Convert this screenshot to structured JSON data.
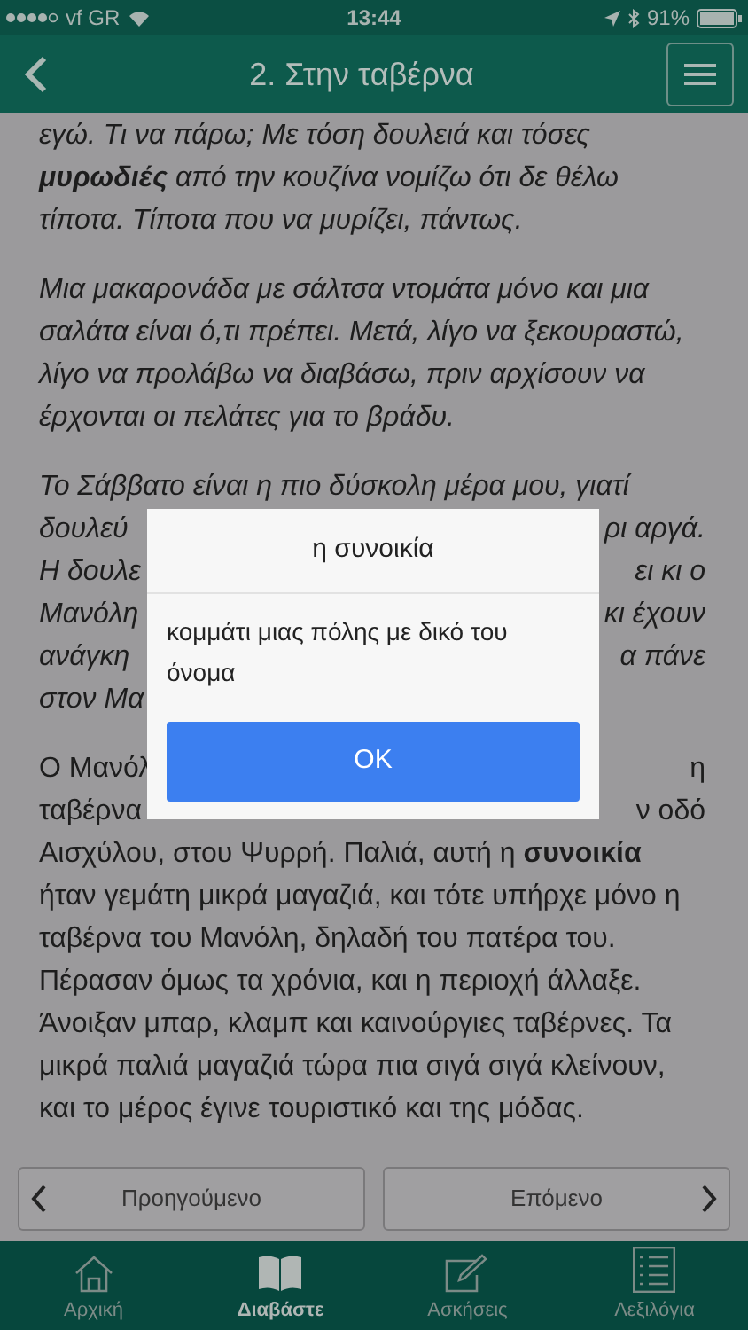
{
  "status_bar": {
    "carrier": "vf GR",
    "time": "13:44",
    "battery": "91%"
  },
  "header": {
    "title": "2. Στην ταβέρνα"
  },
  "paragraphs": [
    {
      "italic": true,
      "lines": [
        {
          "kind": "full",
          "text": "εγώ. Τι να πάρω; Με τόση δουλειά και τόσες"
        },
        {
          "kind": "full",
          "text": "**μυρωδιές** από την κουζίνα νομίζω ότι δε θέλω"
        },
        {
          "kind": "full",
          "text": "τίποτα. Τίποτα που να μυρίζει, πάντως."
        }
      ]
    },
    {
      "italic": true,
      "lines": [
        {
          "kind": "full",
          "text": "Μια μακαρονάδα με σάλτσα ντομάτα μόνο και μια"
        },
        {
          "kind": "full",
          "text": "σαλάτα είναι ό,τι πρέπει. Μετά, λίγο να ξεκουραστώ,"
        },
        {
          "kind": "full",
          "text": "λίγο να προλάβω να διαβάσω, πριν αρχίσουν να"
        },
        {
          "kind": "full",
          "text": "έρχονται οι πελάτες για το βράδυ."
        }
      ]
    },
    {
      "italic": true,
      "lines": [
        {
          "kind": "full",
          "text": "Το Σάββατο είναι η πιο δύσκολη μέρα μου, γιατί"
        },
        {
          "kind": "split",
          "left": "δουλεύ",
          "right": "ρι αργά."
        },
        {
          "kind": "split",
          "left": "Η δουλε",
          "right": "ει κι ο"
        },
        {
          "kind": "split",
          "left": "Μανόλη",
          "right": "κι έχουν"
        },
        {
          "kind": "split",
          "left": "ανάγκη",
          "right": "α πάνε"
        },
        {
          "kind": "split",
          "left": "στον Μα"
        }
      ]
    },
    {
      "italic": false,
      "lines": [
        {
          "kind": "split",
          "left": "Ο Μανόλ",
          "right": "η"
        },
        {
          "kind": "split",
          "left": "ταβέρνα",
          "right": "ν οδό"
        },
        {
          "kind": "full",
          "text": "Αισχύλου, στου Ψυρρή. Παλιά, αυτή η **συνοικία**"
        },
        {
          "kind": "full",
          "text": "ήταν γεμάτη μικρά μαγαζιά, και τότε υπήρχε μόνο η"
        },
        {
          "kind": "full",
          "text": "ταβέρνα του Μανόλη, δηλαδή του πατέρα του."
        },
        {
          "kind": "full",
          "text": "Πέρασαν όμως τα χρόνια, και η περιοχή άλλαξε."
        },
        {
          "kind": "full",
          "text": "Άνοιξαν μπαρ, κλαμπ και καινούργιες ταβέρνες. Τα"
        },
        {
          "kind": "full",
          "text": "μικρά παλιά μαγαζιά τώρα πια σιγά σιγά κλείνουν,"
        },
        {
          "kind": "full",
          "text": "και το μέρος έγινε τουριστικό και της μόδας."
        }
      ]
    }
  ],
  "dialog": {
    "title": "η συνοικία",
    "message": "κομμάτι μιας πόλης με δικό του όνομα",
    "button": "OK"
  },
  "pager": {
    "previous": "Προηγούμενο",
    "next": "Επόμενο"
  },
  "tab_bar": [
    {
      "kind": "home",
      "label": "Αρχική",
      "selected": false
    },
    {
      "kind": "book",
      "label": "Διαβάστε",
      "selected": true
    },
    {
      "kind": "edit",
      "label": "Ασκήσεις",
      "selected": false
    },
    {
      "kind": "list",
      "label": "Λεξιλόγια",
      "selected": false
    }
  ]
}
